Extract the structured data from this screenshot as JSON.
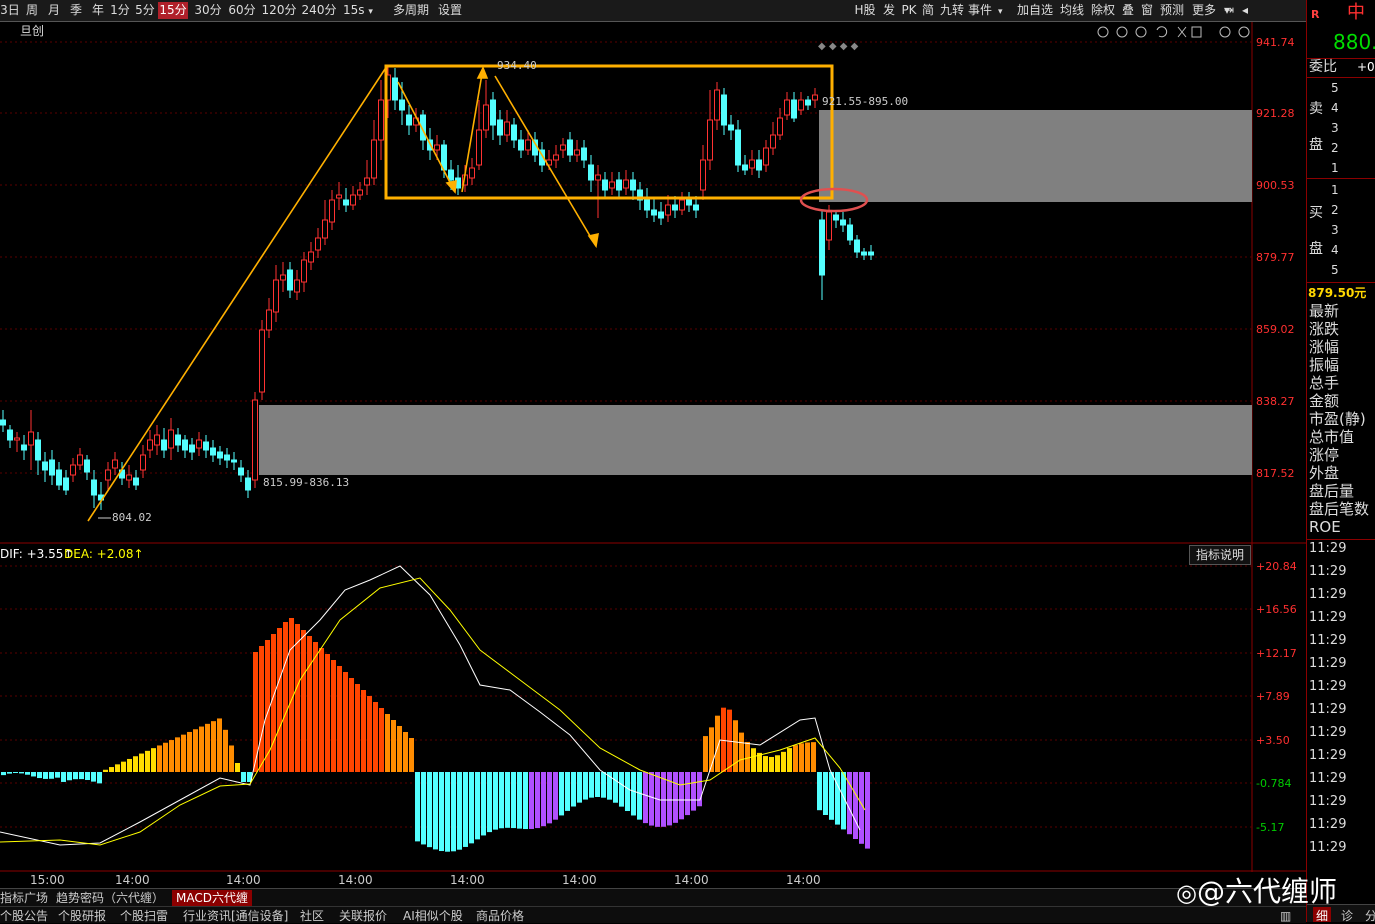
{
  "toolbar": {
    "periods": [
      "3日",
      "周",
      "月",
      "季",
      "年",
      "1分",
      "5分",
      "15分",
      "30分",
      "60分",
      "120分",
      "240分",
      "15s"
    ],
    "active_period": "15分",
    "multi_period": "多周期",
    "settings": "设置",
    "right_buttons": [
      "H股",
      "发",
      "PK",
      "简",
      "九转",
      "事件",
      "加自选",
      "均线",
      "除权",
      "叠",
      "窗",
      "预测",
      "更多"
    ]
  },
  "chart": {
    "title_fragment": "旦创",
    "price_ticks": [
      "941.74",
      "921.28",
      "900.53",
      "879.77",
      "859.02",
      "838.27",
      "817.52"
    ],
    "high_label": "934.40",
    "zone_upper_label": "921.55-895.00",
    "zone_lower_label": "815.99-836.13",
    "low_label": "804.02",
    "macd_dif_label": "DIF: +3.55↑",
    "macd_dea_label": "DEA: +2.08↑",
    "macd_ticks": [
      "+20.84",
      "+16.56",
      "+12.17",
      "+7.89",
      "+3.50",
      "-0.784",
      "-5.17"
    ],
    "time_ticks": [
      "15:00",
      "14:00",
      "14:00",
      "14:00",
      "14:00",
      "14:00",
      "14:00",
      "14:00"
    ],
    "indicator_button": "指标说明"
  },
  "right_panel": {
    "r_mark": "R",
    "name_fragment": "中",
    "price_fragment": "880.",
    "ratio_label": "委比",
    "ratio_value": "+0",
    "sell_label_1": "卖",
    "sell_label_2": "盘",
    "buy_label_1": "买",
    "buy_label_2": "盘",
    "sell_levels": [
      "5",
      "4",
      "3",
      "2",
      "1"
    ],
    "buy_levels": [
      "1",
      "2",
      "3",
      "4",
      "5"
    ],
    "price_unit": "879.50元",
    "fields": [
      "最新",
      "涨跌",
      "涨幅",
      "振幅",
      "总手",
      "金额",
      "市盈(静)",
      "总市值",
      "涨停",
      "外盘",
      "盘后量",
      "盘后笔数",
      "ROE"
    ],
    "times": [
      "11:29",
      "11:29",
      "11:29",
      "11:29",
      "11:29",
      "11:29",
      "11:29",
      "11:29",
      "11:29",
      "11:29",
      "11:29",
      "11:29",
      "11:29",
      "11:29"
    ],
    "bottom_tabs": [
      "细",
      "诊",
      "分"
    ]
  },
  "bottom_tabs_1": [
    "指标广场",
    "趋势密码（六代缠）",
    "MACD六代缠"
  ],
  "bottom_tabs_1_active": "MACD六代缠",
  "bottom_tabs_2": [
    "个股公告",
    "个股研报",
    "个股扫雷",
    "行业资讯[通信设备]",
    "社区",
    "关联报价",
    "AI相似个股",
    "商品价格"
  ],
  "watermark": "@六代缠师",
  "colors": {
    "up": "#ff3232",
    "down": "#54ffff",
    "zone": "#808080",
    "annotation": "#ffb000",
    "circle": "#e05050"
  }
}
